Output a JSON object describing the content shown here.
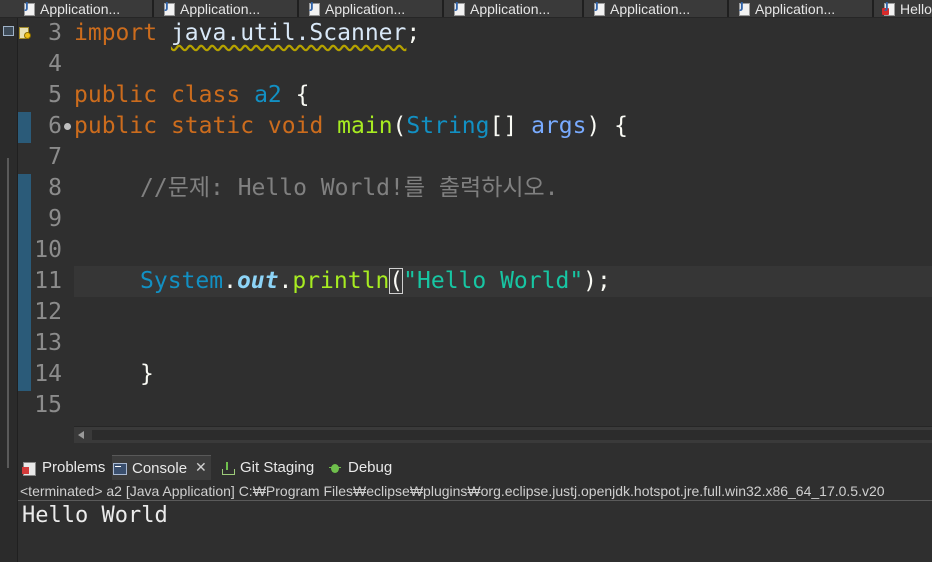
{
  "editor_tabs": [
    {
      "label": "Application..."
    },
    {
      "label": "Application..."
    },
    {
      "label": "Application..."
    },
    {
      "label": "Application..."
    },
    {
      "label": "Application..."
    },
    {
      "label": "Application..."
    },
    {
      "label": "Hello"
    }
  ],
  "code": {
    "lines": [
      {
        "num": "3"
      },
      {
        "num": "4"
      },
      {
        "num": "5"
      },
      {
        "num": "6"
      },
      {
        "num": "7"
      },
      {
        "num": "8"
      },
      {
        "num": "9"
      },
      {
        "num": "10"
      },
      {
        "num": "11"
      },
      {
        "num": "12"
      },
      {
        "num": "13"
      },
      {
        "num": "14"
      },
      {
        "num": "15"
      }
    ],
    "tokens": {
      "import_kw": "import",
      "import_path": "java.util.Scanner",
      "semicolon": ";",
      "public_kw": "public",
      "class_kw": "class",
      "class_name": "a2",
      "open_brace": "{",
      "static_kw": "static",
      "void_kw": "void",
      "method_name": "main",
      "string_type": "String",
      "array_brackets": "[]",
      "param_name": "args",
      "comment": "//문제: Hello World!를 출력하시오.",
      "system": "System",
      "out": "out",
      "println": "println",
      "string_literal": "\"Hello World\"",
      "close_brace": "}"
    }
  },
  "bottom_panel": {
    "tabs": [
      {
        "label": "Problems",
        "icon": "problems-icon"
      },
      {
        "label": "Console",
        "icon": "console-icon",
        "close": "✕"
      },
      {
        "label": "Git Staging",
        "icon": "git-staging-icon"
      },
      {
        "label": "Debug",
        "icon": "debug-icon"
      }
    ],
    "console_header": "<terminated> a2 [Java Application] C:₩Program Files₩eclipse₩plugins₩org.eclipse.justj.openjdk.hotspot.jre.full.win32.x86_64_17.0.5.v20",
    "output": "Hello World"
  },
  "colors": {
    "background": "#2f2f2f",
    "keyword": "#cc6c1d",
    "string": "#17c6a3",
    "method": "#a7ec21",
    "comment": "#808080"
  }
}
